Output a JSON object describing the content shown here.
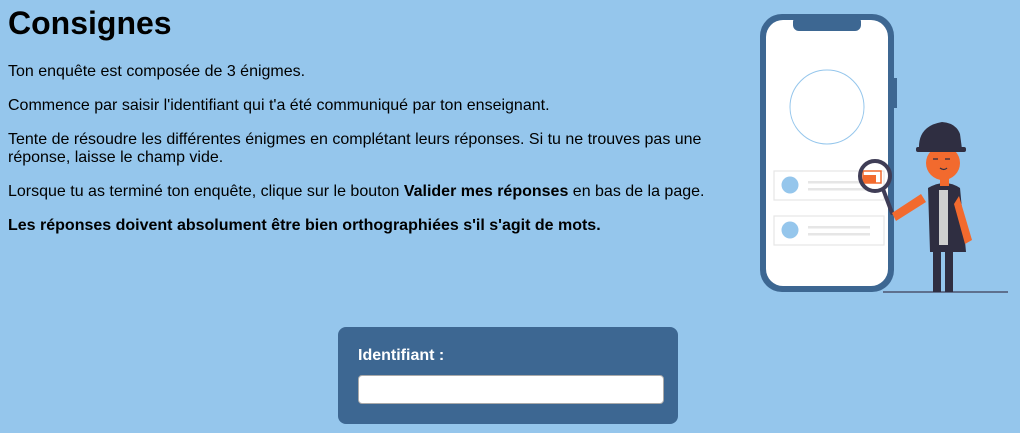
{
  "instructions": {
    "title": "Consignes",
    "p1": "Ton enquête est composée de 3 énigmes.",
    "p2": "Commence par saisir l'identifiant qui t'a été communiqué par ton enseignant.",
    "p3": "Tente de résoudre les différentes énigmes en complétant leurs réponses. Si tu ne trouves pas une réponse, laisse le champ vide.",
    "p4_before": "Lorsque tu as terminé ton enquête, clique sur le bouton ",
    "p4_bold": "Valider mes réponses",
    "p4_after": " en bas de la page.",
    "p5": "Les réponses doivent absolument être bien orthographiées s'il s'agit de mots."
  },
  "identifier": {
    "label": "Identifiant :",
    "value": "",
    "placeholder": ""
  },
  "colors": {
    "background": "#95c6ec",
    "card": "#3d6792",
    "accent": "#f26a2e",
    "phone_frame": "#3d6792"
  },
  "illustration": {
    "icon": "detective-phone-illustration"
  }
}
